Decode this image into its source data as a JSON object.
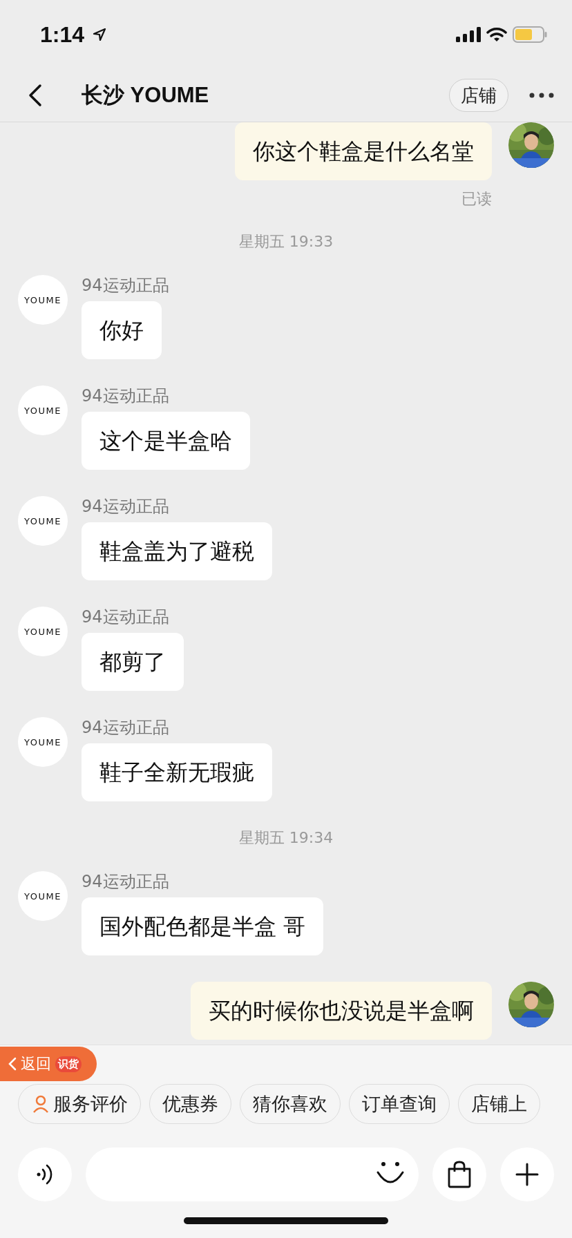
{
  "status_bar": {
    "time": "1:14"
  },
  "nav": {
    "title": "长沙 YOUME",
    "shop_button": "店铺"
  },
  "messages": [
    {
      "kind": "outgoing",
      "text": "你这个鞋盒是什么名堂"
    },
    {
      "kind": "receipt",
      "text": "已读"
    },
    {
      "kind": "time",
      "text": "星期五 19:33"
    },
    {
      "kind": "incoming",
      "sender": "94运动正品",
      "avatar_text": "YOUME",
      "text": "你好"
    },
    {
      "kind": "incoming",
      "sender": "94运动正品",
      "avatar_text": "YOUME",
      "text": "这个是半盒哈"
    },
    {
      "kind": "incoming",
      "sender": "94运动正品",
      "avatar_text": "YOUME",
      "text": "鞋盒盖为了避税"
    },
    {
      "kind": "incoming",
      "sender": "94运动正品",
      "avatar_text": "YOUME",
      "text": "都剪了"
    },
    {
      "kind": "incoming",
      "sender": "94运动正品",
      "avatar_text": "YOUME",
      "text": "鞋子全新无瑕疵"
    },
    {
      "kind": "time",
      "text": "星期五 19:34"
    },
    {
      "kind": "incoming",
      "sender": "94运动正品",
      "avatar_text": "YOUME",
      "text": "国外配色都是半盒 哥"
    },
    {
      "kind": "outgoing",
      "text": "买的时候你也没说是半盒啊"
    }
  ],
  "return_banner": {
    "label": "返回",
    "app_badge": "识货"
  },
  "quick_chips": [
    {
      "kind": "with-icon",
      "label": "服务评价"
    },
    {
      "kind": "plain",
      "label": "优惠券"
    },
    {
      "kind": "plain",
      "label": "猜你喜欢"
    },
    {
      "kind": "plain",
      "label": "订单查询"
    },
    {
      "kind": "plain",
      "label": "店铺上"
    }
  ]
}
